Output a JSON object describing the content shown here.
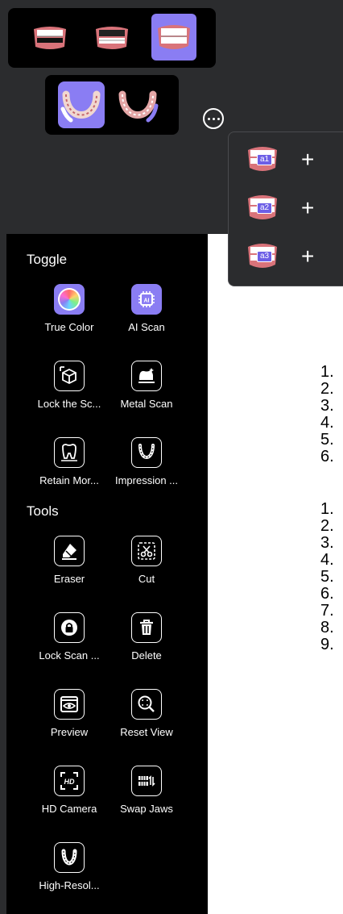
{
  "panel": {
    "toggle_heading": "Toggle",
    "tools_heading": "Tools",
    "toggles": [
      {
        "label": "True Color",
        "icon": "color-wheel-icon"
      },
      {
        "label": "AI Scan",
        "icon": "ai-chip-icon"
      },
      {
        "label": "Lock the Sc...",
        "icon": "lock-cube-icon"
      },
      {
        "label": "Metal Scan",
        "icon": "metal-tooth-icon"
      },
      {
        "label": "Retain Mor...",
        "icon": "tooth-outline-icon"
      },
      {
        "label": "Impression ...",
        "icon": "impression-arch-icon"
      }
    ],
    "tools": [
      {
        "label": "Eraser",
        "icon": "eraser-icon"
      },
      {
        "label": "Cut",
        "icon": "scissors-icon"
      },
      {
        "label": "Lock Scan ...",
        "icon": "lock-icon"
      },
      {
        "label": "Delete",
        "icon": "trash-icon"
      },
      {
        "label": "Preview",
        "icon": "eye-icon"
      },
      {
        "label": "Reset View",
        "icon": "zoom-fit-icon"
      },
      {
        "label": "HD Camera",
        "icon": "hd-camera-icon"
      },
      {
        "label": "Swap Jaws",
        "icon": "swap-jaws-icon"
      },
      {
        "label": "High-Resol...",
        "icon": "high-res-arch-icon"
      }
    ]
  },
  "jaw_views": [
    "upper-jaw",
    "lower-jaw",
    "both-jaws"
  ],
  "arch_views": [
    "upper-arch",
    "lower-arch"
  ],
  "scan_slots": [
    {
      "tag": "a1",
      "add": "+"
    },
    {
      "tag": "a2",
      "add": "+"
    },
    {
      "tag": "a3",
      "add": "+"
    }
  ],
  "list_a": [
    "1.",
    "2.",
    "3.",
    "4.",
    "5.",
    "6."
  ],
  "list_b": [
    "1.",
    "2.",
    "3.",
    "4.",
    "5.",
    "6.",
    "7.",
    "8.",
    "9."
  ],
  "colors": {
    "accent": "#8a7df3",
    "panel": "#000000",
    "chrome": "#2b2c2e"
  }
}
